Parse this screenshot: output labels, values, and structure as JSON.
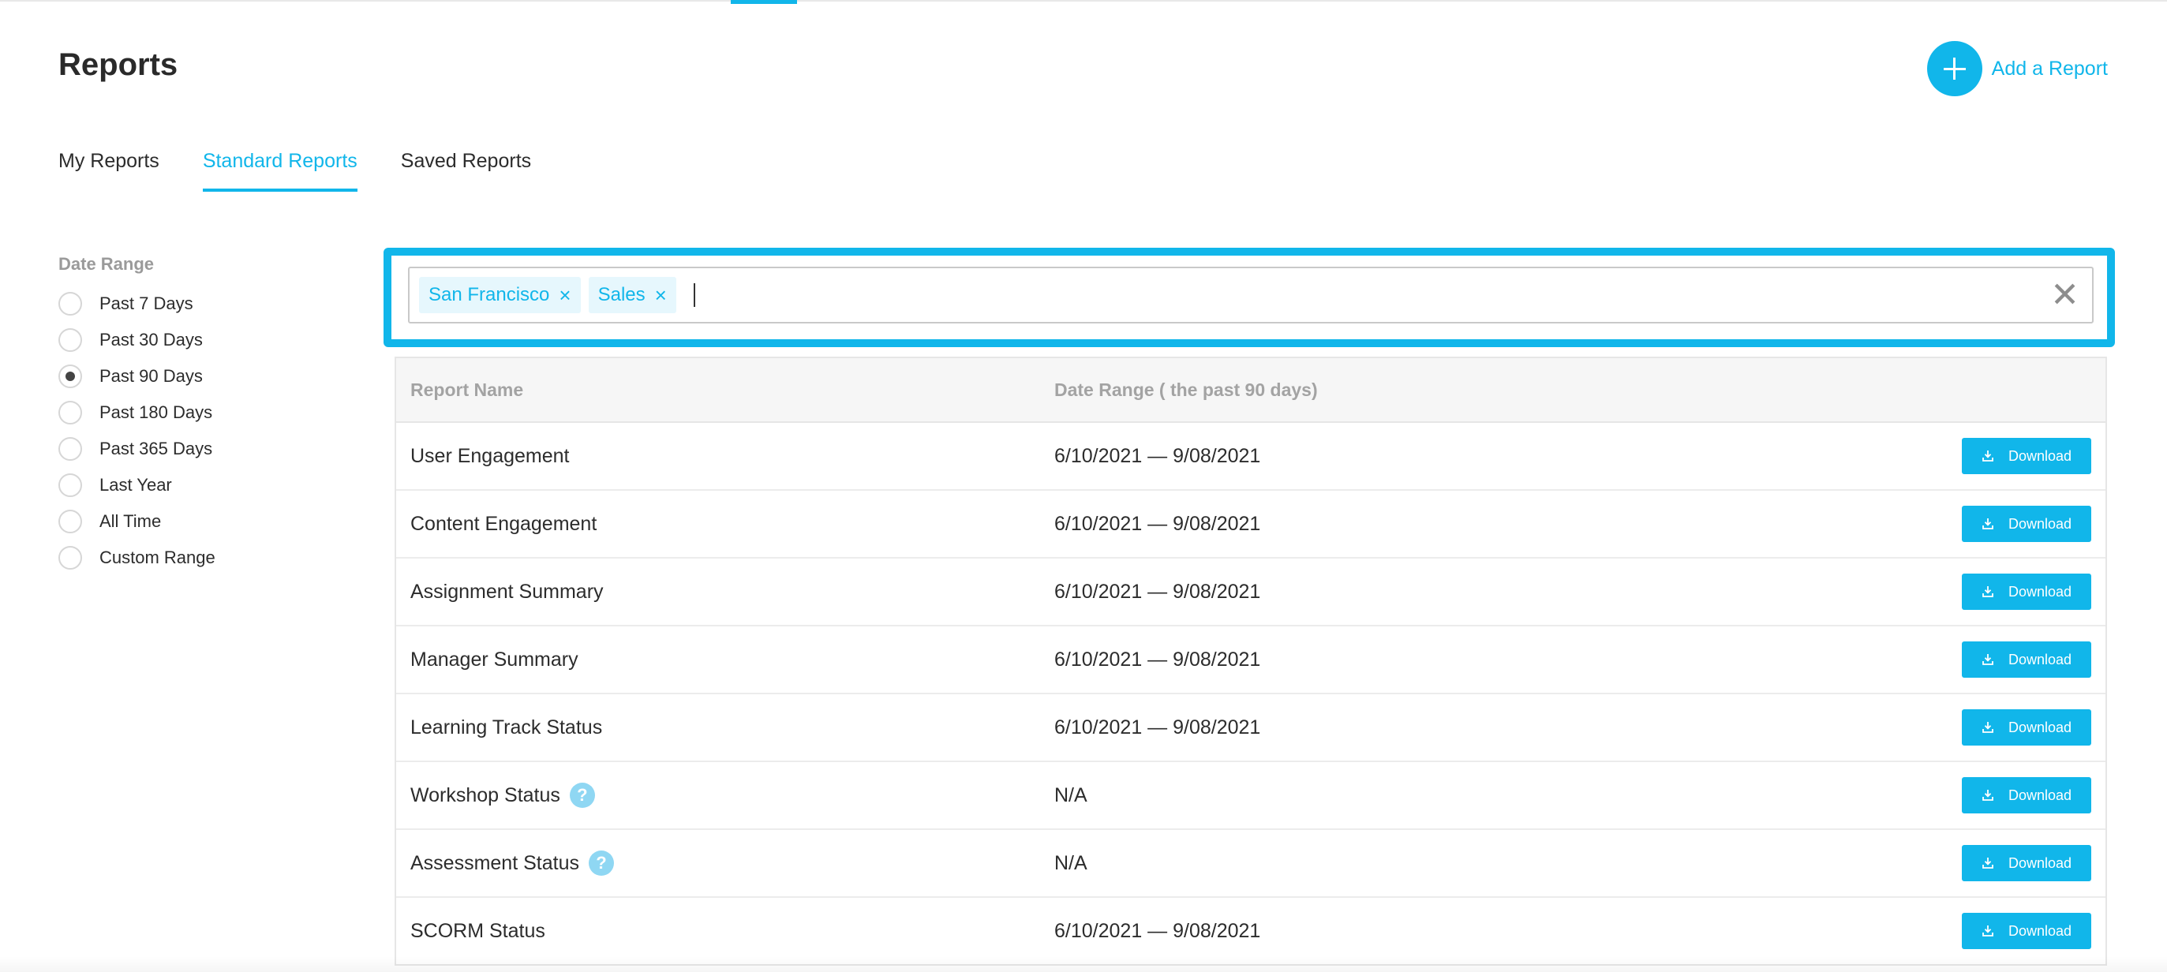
{
  "page": {
    "title": "Reports"
  },
  "header": {
    "add_report_label": "Add a Report"
  },
  "tabs": [
    {
      "label": "My Reports",
      "active": false
    },
    {
      "label": "Standard Reports",
      "active": true
    },
    {
      "label": "Saved Reports",
      "active": false
    }
  ],
  "filters": {
    "heading": "Date Range",
    "options": [
      {
        "label": "Past 7 Days",
        "checked": false
      },
      {
        "label": "Past 30 Days",
        "checked": false
      },
      {
        "label": "Past 90 Days",
        "checked": true
      },
      {
        "label": "Past 180 Days",
        "checked": false
      },
      {
        "label": "Past 365 Days",
        "checked": false
      },
      {
        "label": "Last Year",
        "checked": false
      },
      {
        "label": "All Time",
        "checked": false
      },
      {
        "label": "Custom Range",
        "checked": false
      }
    ]
  },
  "search": {
    "chips": [
      {
        "label": "San Francisco",
        "remove": "×"
      },
      {
        "label": "Sales",
        "remove": "×"
      }
    ],
    "clear": "✕"
  },
  "table": {
    "headers": {
      "name": "Report Name",
      "date": "Date Range ( the past 90 days)"
    },
    "rows": [
      {
        "name": "User Engagement",
        "date": "6/10/2021 — 9/08/2021",
        "help": false,
        "action": "Download"
      },
      {
        "name": "Content Engagement",
        "date": "6/10/2021 — 9/08/2021",
        "help": false,
        "action": "Download"
      },
      {
        "name": "Assignment Summary",
        "date": "6/10/2021 — 9/08/2021",
        "help": false,
        "action": "Download"
      },
      {
        "name": "Manager Summary",
        "date": "6/10/2021 — 9/08/2021",
        "help": false,
        "action": "Download"
      },
      {
        "name": "Learning Track Status",
        "date": "6/10/2021 — 9/08/2021",
        "help": false,
        "action": "Download"
      },
      {
        "name": "Workshop Status",
        "date": "N/A",
        "help": true,
        "action": "Download"
      },
      {
        "name": "Assessment Status",
        "date": "N/A",
        "help": true,
        "action": "Download"
      },
      {
        "name": "SCORM Status",
        "date": "6/10/2021 — 9/08/2021",
        "help": false,
        "action": "Download"
      }
    ],
    "help_glyph": "?"
  },
  "icons": {
    "add": "plus-icon",
    "download": "download-icon",
    "help": "help-circle-icon",
    "clear": "close-icon"
  },
  "colors": {
    "accent": "#11b6ea",
    "chip_bg": "#e6f7fd",
    "help_bg": "#8fd7f3"
  }
}
